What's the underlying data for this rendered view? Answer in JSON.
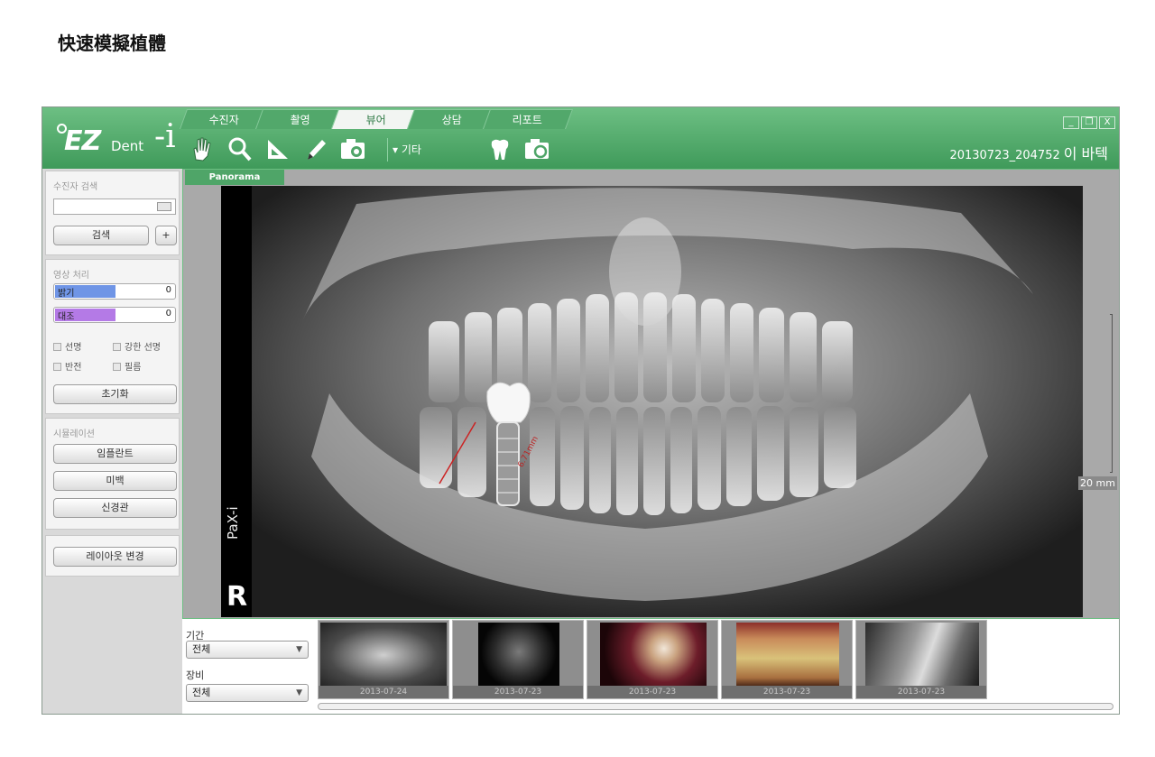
{
  "page_title": "快速模擬植體",
  "app": {
    "logo": {
      "ez": "EZ",
      "dent": "Dent",
      "i": "-i"
    },
    "tabs": [
      {
        "label": "수진자"
      },
      {
        "label": "촬영"
      },
      {
        "label": "뷰어"
      },
      {
        "label": "상담"
      },
      {
        "label": "리포트"
      }
    ],
    "active_tab": "뷰어",
    "toolbar": {
      "icons": [
        "hand-pan-icon",
        "magnifier-icon",
        "ruler-angle-icon",
        "pen-icon",
        "camera-capture-icon",
        "tooth-implant-icon",
        "camera-refresh-icon"
      ],
      "etc_label": "▾ 기타"
    },
    "patient": {
      "id": "20130723_204752",
      "name": "이 바텍"
    },
    "window_controls": [
      "_",
      "❐",
      "X"
    ],
    "accent_color": "#4fa568"
  },
  "search_panel": {
    "title": "수진자 검색",
    "input_value": "",
    "search_button": "검색",
    "add_button": "+"
  },
  "image_panel": {
    "title": "영상 처리",
    "brightness": {
      "label": "밝기",
      "value": "0",
      "fill_color": "#6f95e6",
      "fill_fraction": 0.5
    },
    "contrast": {
      "label": "대조",
      "value": "0",
      "fill_color": "#b47ae6",
      "fill_fraction": 0.5
    },
    "checkboxes": [
      {
        "label": "선명",
        "checked": false
      },
      {
        "label": "강한 선명",
        "checked": false
      },
      {
        "label": "반전",
        "checked": false
      },
      {
        "label": "필름",
        "checked": false
      }
    ],
    "reset_button": "초기화"
  },
  "sim_panel": {
    "title": "시뮬레이션",
    "buttons": [
      "임플란트",
      "미백",
      "신경관"
    ]
  },
  "layout_button": "레이아웃 변경",
  "viewer": {
    "tab_label": "Panorama",
    "device_label": "PaX-i",
    "side_marker": "R",
    "measurement": "6.71mm",
    "scale_label": "20 mm"
  },
  "filters": {
    "period_label": "기간",
    "period_value": "전체",
    "device_label": "장비",
    "device_value": "전체"
  },
  "thumbnails": [
    {
      "date": "2013-07-24",
      "kind": "panorama"
    },
    {
      "date": "2013-07-23",
      "kind": "ct"
    },
    {
      "date": "2013-07-23",
      "kind": "intraoral-photo"
    },
    {
      "date": "2013-07-23",
      "kind": "teeth-photo"
    },
    {
      "date": "2013-07-23",
      "kind": "periapical"
    }
  ]
}
